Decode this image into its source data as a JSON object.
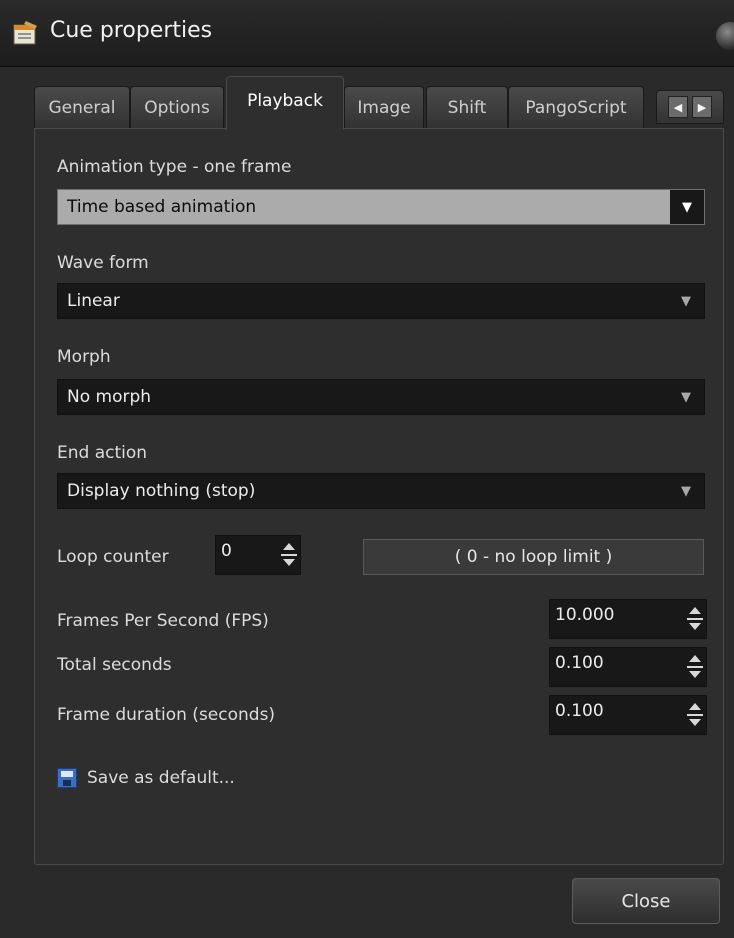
{
  "window": {
    "title": "Cue properties"
  },
  "tabs": [
    "General",
    "Options",
    "Playback",
    "Image",
    "Shift",
    "PangoScript"
  ],
  "active_tab": "Playback",
  "animation_type": {
    "label": "Animation type - one frame",
    "value": "Time based animation"
  },
  "wave_form": {
    "label": "Wave form",
    "value": "Linear"
  },
  "morph": {
    "label": "Morph",
    "value": "No morph"
  },
  "end_action": {
    "label": "End action",
    "value": "Display nothing (stop)"
  },
  "loop_counter": {
    "label": "Loop counter",
    "value": "0",
    "note": "( 0 - no loop limit )"
  },
  "fps": {
    "label": "Frames Per Second (FPS)",
    "value": "10.000"
  },
  "total_seconds": {
    "label": "Total seconds",
    "value": "0.100"
  },
  "frame_duration": {
    "label": "Frame duration (seconds)",
    "value": "0.100"
  },
  "save_default": {
    "label": "Save as default..."
  },
  "buttons": {
    "close": "Close"
  },
  "icons": {
    "app": "cue-properties-icon",
    "save": "floppy-disk-icon",
    "dropdown": "chevron-down-icon"
  }
}
